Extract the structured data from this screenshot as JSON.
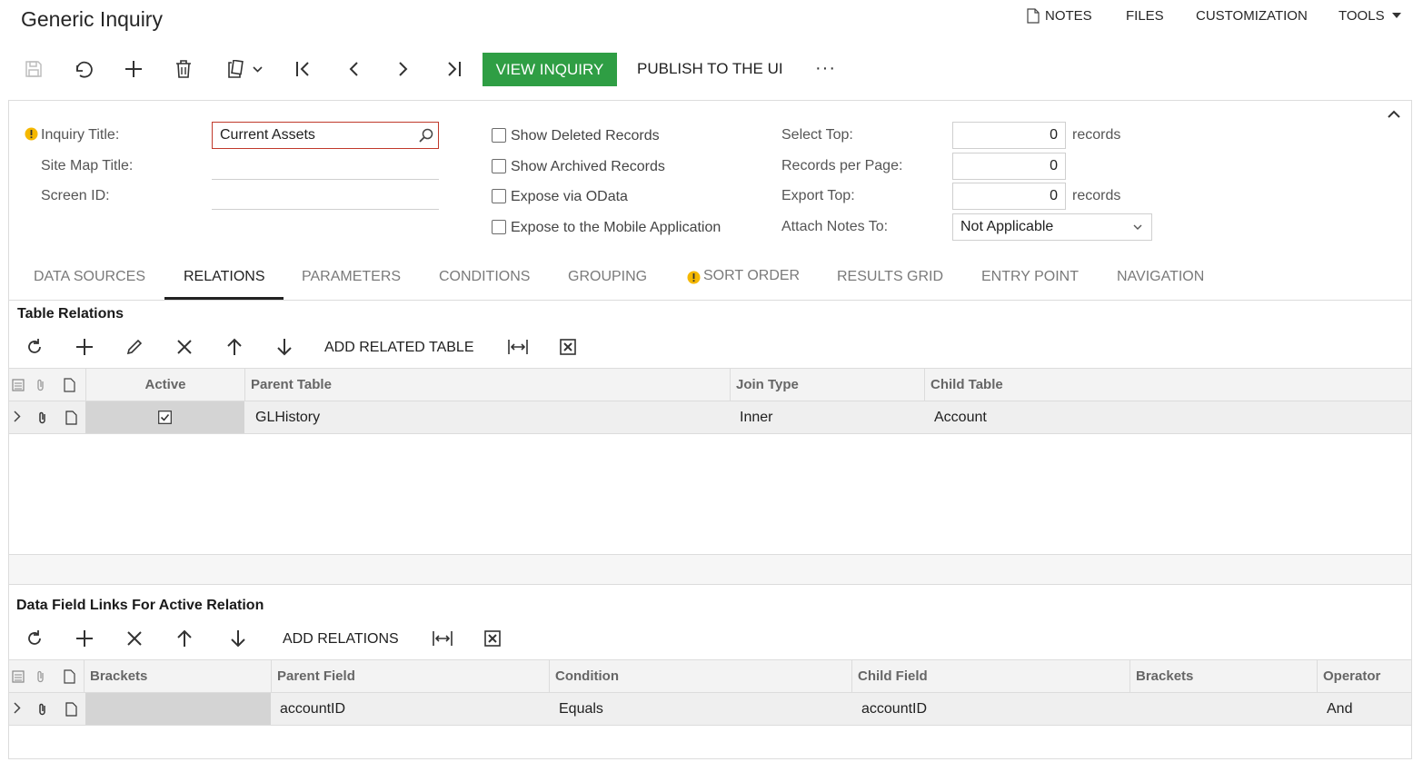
{
  "page": {
    "title": "Generic Inquiry"
  },
  "topmenu": {
    "notes": "NOTES",
    "files": "FILES",
    "customization": "CUSTOMIZATION",
    "tools": "TOOLS"
  },
  "toolbar": {
    "view_inquiry": "VIEW INQUIRY",
    "publish": "PUBLISH TO THE UI",
    "more": "···"
  },
  "form": {
    "inquiry_title_label": "Inquiry Title:",
    "inquiry_title_value": "Current Assets",
    "site_map_title_label": "Site Map Title:",
    "site_map_title_value": "",
    "screen_id_label": "Screen ID:",
    "screen_id_value": "",
    "show_deleted": "Show Deleted Records",
    "show_archived": "Show Archived Records",
    "expose_odata": "Expose via OData",
    "expose_mobile": "Expose to the Mobile Application",
    "select_top_label": "Select Top:",
    "select_top_value": "0",
    "select_top_unit": "records",
    "records_per_page_label": "Records per Page:",
    "records_per_page_value": "0",
    "export_top_label": "Export Top:",
    "export_top_value": "0",
    "export_top_unit": "records",
    "attach_notes_label": "Attach Notes To:",
    "attach_notes_value": "Not Applicable"
  },
  "tabs": [
    "DATA SOURCES",
    "RELATIONS",
    "PARAMETERS",
    "CONDITIONS",
    "GROUPING",
    "SORT ORDER",
    "RESULTS GRID",
    "ENTRY POINT",
    "NAVIGATION"
  ],
  "table_relations": {
    "title": "Table Relations",
    "add_label": "ADD RELATED TABLE",
    "columns": [
      "Active",
      "Parent Table",
      "Join Type",
      "Child Table"
    ],
    "rows": [
      {
        "active": true,
        "parent_table": "GLHistory",
        "join_type": "Inner",
        "child_table": "Account"
      }
    ]
  },
  "field_links": {
    "title": "Data Field Links For Active Relation",
    "add_label": "ADD RELATIONS",
    "columns": [
      "Brackets",
      "Parent Field",
      "Condition",
      "Child Field",
      "Brackets",
      "Operator"
    ],
    "rows": [
      {
        "brackets_open": "",
        "parent_field": "accountID",
        "condition": "Equals",
        "child_field": "accountID",
        "brackets_close": "",
        "operator": "And"
      }
    ]
  },
  "colors": {
    "accent_green": "#2f9e44",
    "warning": "#f5b800",
    "error_border": "#c0392b"
  }
}
